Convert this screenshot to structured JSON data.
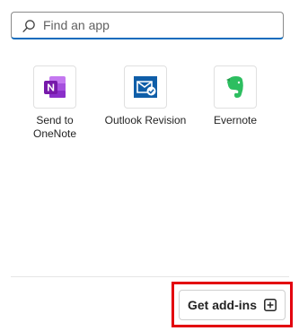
{
  "search": {
    "placeholder": "Find an app",
    "value": ""
  },
  "apps": [
    {
      "label_line1": "Send to",
      "label_line2": "OneNote",
      "icon": "onenote-icon"
    },
    {
      "label_line1": "Outlook Revision",
      "label_line2": "",
      "icon": "outlook-revision-icon"
    },
    {
      "label_line1": "Evernote",
      "label_line2": "",
      "icon": "evernote-icon"
    }
  ],
  "footer": {
    "get_addins_label": "Get add-ins",
    "icon": "add-box-icon"
  },
  "colors": {
    "search_underline": "#0f6cbd",
    "highlight_border": "#e3000f",
    "onenote": "#7719aa",
    "outlook": "#0f5ea8",
    "evernote": "#2dbe60"
  }
}
